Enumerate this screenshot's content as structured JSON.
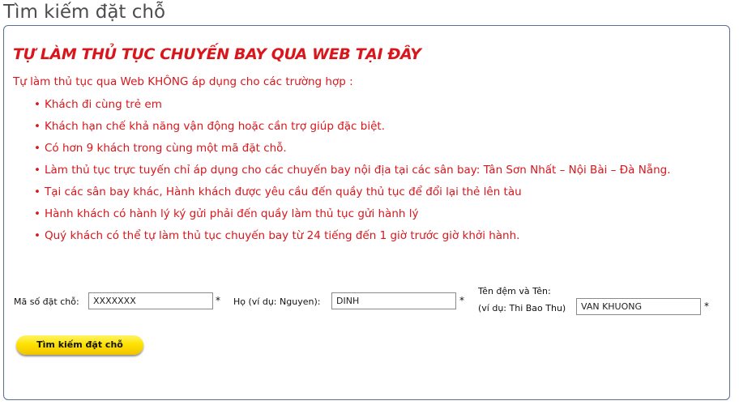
{
  "page": {
    "title": "Tìm kiếm đặt chỗ"
  },
  "panel": {
    "heading": "TỰ LÀM THỦ TỤC CHUYẾN BAY QUA WEB TẠI ĐÂY",
    "intro": "Tự làm thủ tục qua Web KHÔNG áp dụng cho các trường hợp :",
    "rules": [
      "Khách đi cùng trẻ em",
      "Khách hạn chế khả năng vận động hoặc cần trợ giúp đặc biệt.",
      "Có hơn 9 khách trong cùng một mã đặt chỗ.",
      "Làm thủ tục trực tuyến chỉ áp dụng cho các chuyến bay nội địa tại các sân bay: Tân Sơn Nhất – Nội Bài – Đà Nẵng.",
      "Tại các sân bay khác, Hành khách được yêu cầu đến quầy thủ tục để đổi lại thẻ lên tàu",
      "Hành khách có hành lý ký gửi phải đến quầy làm thủ tục gửi hành lý",
      "Quý khách có thể tự làm thủ tục chuyến bay từ 24 tiếng đến 1 giờ trước giờ khởi hành."
    ],
    "bullet": "•",
    "colors": {
      "accent_red": "#d9161c",
      "panel_border": "#5a6f93",
      "button_yellow": "#fde300"
    }
  },
  "form": {
    "booking_code": {
      "label": "Mã số đặt chỗ:",
      "value": "XXXXXXX",
      "required": "*"
    },
    "last_name": {
      "label": "Họ (ví dụ: Nguyen):",
      "value": "DINH",
      "required": "*"
    },
    "first_name": {
      "label_line1": "Tên đệm và Tên:",
      "label_line2": "(ví dụ: Thi Bao Thu)",
      "value": "VAN KHUONG",
      "required": "*"
    },
    "submit_label": "Tìm kiếm đặt chỗ"
  }
}
